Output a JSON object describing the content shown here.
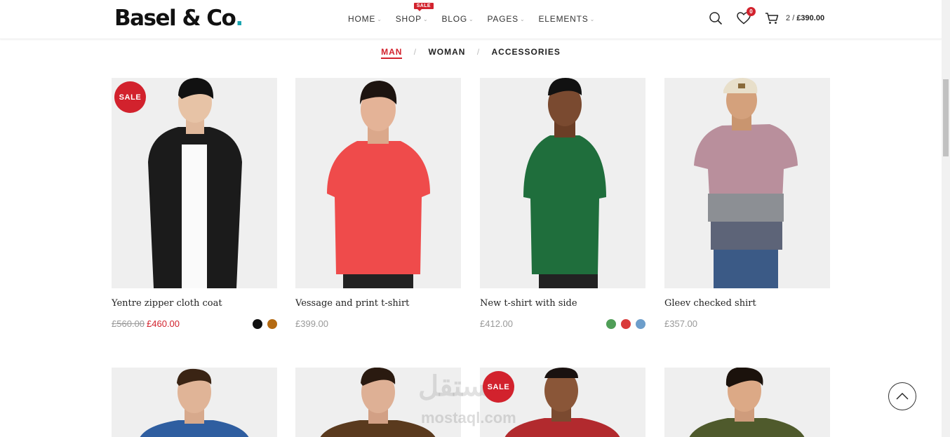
{
  "brand": {
    "name": "Basel & Co",
    "dot": "."
  },
  "nav": [
    {
      "label": "HOME"
    },
    {
      "label": "SHOP",
      "tag": "SALE"
    },
    {
      "label": "BLOG"
    },
    {
      "label": "PAGES"
    },
    {
      "label": "ELEMENTS"
    }
  ],
  "header": {
    "wishlist_count": "0",
    "cart_count": "2",
    "cart_sep": "/",
    "cart_total": "£390.00"
  },
  "categories": [
    {
      "label": "MAN",
      "active": true
    },
    {
      "label": "WOMAN",
      "active": false
    },
    {
      "label": "ACCESSORIES",
      "active": false
    }
  ],
  "category_separator": "/",
  "products": [
    {
      "name": "Yentre zipper cloth coat",
      "old_price": "£560.00",
      "price": "£460.00",
      "sale": "SALE",
      "swatches": [
        "#111111",
        "#b46a12"
      ],
      "shirt": "#1b1b1b"
    },
    {
      "name": "Vessage and print t-shirt",
      "price": "£399.00",
      "swatches": [],
      "shirt": "#ef4b4b"
    },
    {
      "name": "New t-shirt with side",
      "price": "£412.00",
      "swatches": [
        "#4f9e57",
        "#d93a3a",
        "#6d9ecb"
      ],
      "shirt": "#1f6e3c"
    },
    {
      "name": "Gleev checked shirt",
      "price": "£357.00",
      "swatches": [],
      "shirt": "#b98f9c"
    }
  ],
  "products_row2": [
    {
      "shirt": "#2f5ea0"
    },
    {
      "shirt": "#5a3a1e"
    },
    {
      "shirt": "#b22a2e",
      "sale": "SALE"
    },
    {
      "shirt": "#4f5a2c"
    }
  ],
  "watermark": {
    "text": "مستقل",
    "url": "mostaql.com"
  }
}
